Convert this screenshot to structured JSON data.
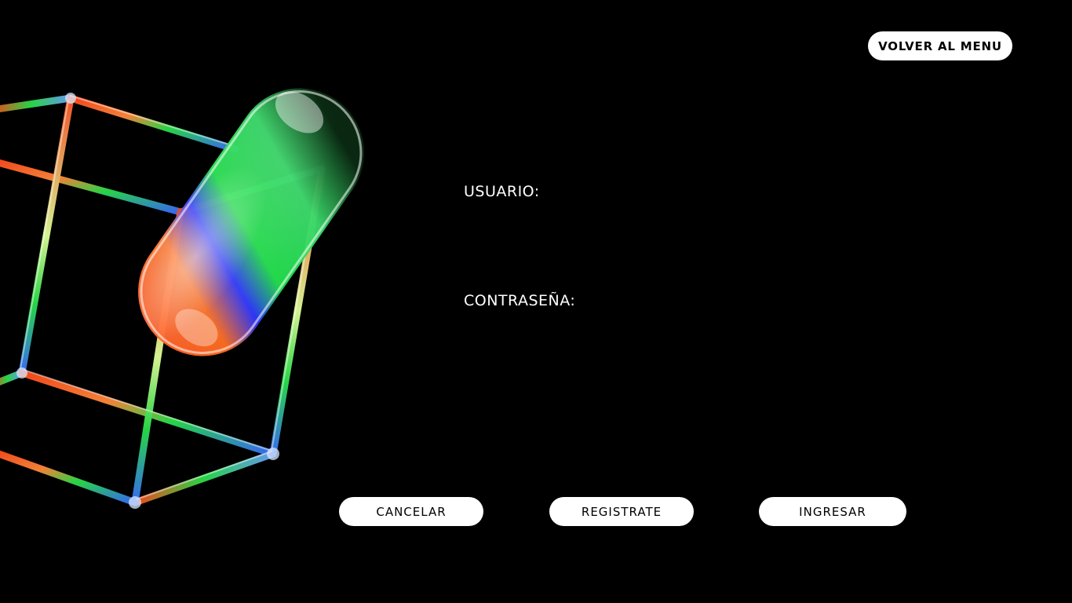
{
  "header": {
    "back_to_menu_label": "VOLVER AL MENU"
  },
  "form": {
    "username_label": "USUARIO:",
    "username_value": "",
    "password_label": "CONTRASEÑA:",
    "password_value": ""
  },
  "actions": {
    "cancel_label": "CANCELAR",
    "register_label": "REGISTRATE",
    "login_label": "INGRESAR"
  },
  "decoration": {
    "icon": "glass-cube-and-capsule-art",
    "colors": {
      "background": "#000000",
      "button_bg": "#ffffff",
      "button_text": "#000000",
      "accent_red": "#ff4a1c",
      "accent_green": "#29e04a",
      "accent_blue": "#2a5cff"
    }
  }
}
